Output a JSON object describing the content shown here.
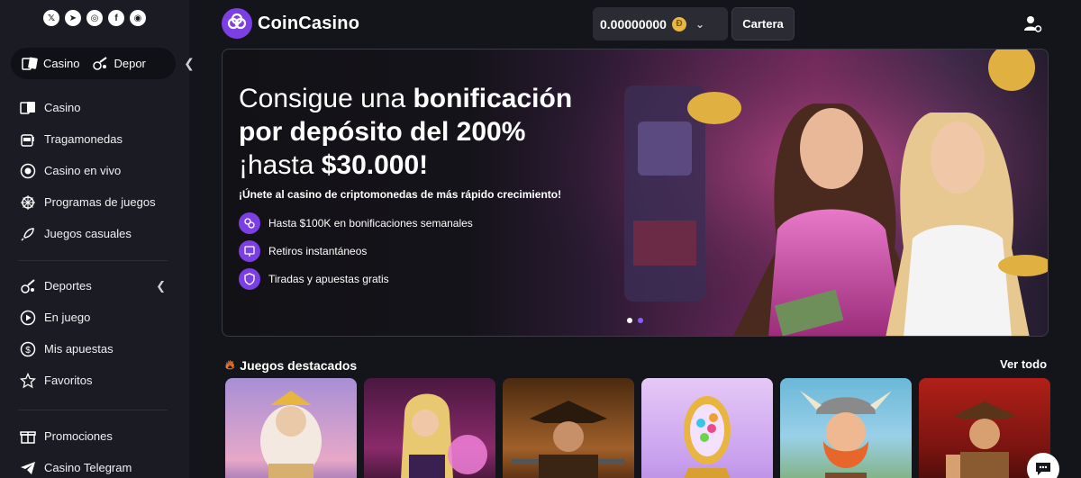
{
  "social": [
    "X",
    "telegram",
    "instagram",
    "facebook",
    "discord"
  ],
  "switcher": {
    "casino": "Casino",
    "sports": "Depor"
  },
  "nav": {
    "casino": "Casino",
    "slots": "Tragamonedas",
    "live_casino": "Casino en vivo",
    "game_shows": "Programas de juegos",
    "casual": "Juegos casuales",
    "sports": "Deportes",
    "in_play": "En juego",
    "my_bets": "Mis apuestas",
    "favorites": "Favoritos",
    "promotions": "Promociones",
    "telegram": "Casino Telegram"
  },
  "header": {
    "brand": "CoinCasino",
    "balance": "0.00000000",
    "wallet": "Cartera"
  },
  "banner": {
    "title_part1": "Consigue una ",
    "title_bold1": "bonificación",
    "title_bold2": "por depósito del 200%",
    "title_part3": "¡hasta ",
    "title_bold3": "$30.000!",
    "subtitle": "¡Únete al casino de criptomonedas de más rápido crecimiento!",
    "features": [
      "Hasta $100K en bonificaciones semanales",
      "Retiros instantáneos",
      "Tiradas y apuestas gratis"
    ]
  },
  "featured": {
    "title": "Juegos destacados",
    "see_all": "Ver todo"
  },
  "colors": {
    "accent": "#7b3fe4",
    "sidebar": "#1b1c23",
    "background": "#14151a"
  }
}
